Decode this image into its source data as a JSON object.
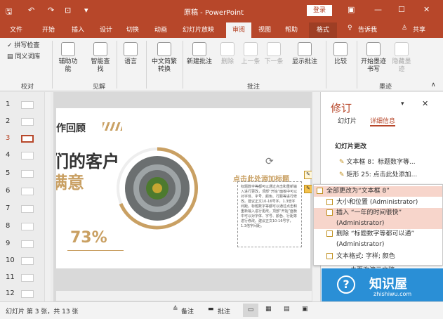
{
  "title_bar": {
    "title": "原稿 - PowerPoint",
    "login": "登录"
  },
  "tabs": [
    "文件",
    "开始",
    "插入",
    "设计",
    "切换",
    "动画",
    "幻灯片放映",
    "审阅",
    "视图",
    "帮助",
    "格式",
    "告诉我",
    "共享"
  ],
  "ribbon": {
    "spell": "拼写检查",
    "thesaurus": "同义词库",
    "g_proof": "校对",
    "accessibility": "辅助功能",
    "smart_lookup": "智能查找",
    "g_insight": "见解",
    "language": "语言",
    "chinese_conv": "中文简繁转换",
    "new_comment": "新建批注",
    "delete": "删除",
    "prev": "上一条",
    "next": "下一条",
    "show_comments": "显示批注",
    "g_comments": "批注",
    "compare": "比较",
    "start_ink": "开始墨迹书写",
    "hide_ink": "隐藏墨迹",
    "g_ink": "墨迹"
  },
  "thumbs": [
    "1",
    "2",
    "3",
    "4",
    "5",
    "6",
    "7",
    "8",
    "9",
    "10",
    "11",
    "12"
  ],
  "slide": {
    "heading": "作回顾",
    "title_line": "们的客户",
    "title_line2": "满意",
    "percent": "73%",
    "placeholder": "点击此处添加标题",
    "body_text": "标题数字等都可以通过点击和重新输入进行更改，顶部“开始”面板中可以对字体、字号、颜色、行距等进行修改。建议正文10-16号字，1.3倍字间距。标题数字等都可以通过点击和重新输入进行更改，顶部“开始”面板中可以对字体、字号、颜色、行距等进行修改。建议正文10-16号字，1.3倍字间距。"
  },
  "revision": {
    "title": "修订",
    "tab_slides": "幻灯片",
    "tab_details": "详细信息",
    "section": "幻灯片更改",
    "changes": [
      "文本框 8：标题数字等...",
      "矩形 25: 点击此处添加..."
    ],
    "footer": "未更改演示文稿。"
  },
  "popup": {
    "all": "全部更改为“文本框 8”",
    "items": [
      "大小和位置 (Administrator)",
      "插入 “一年的时间很快”",
      "(Administrator)",
      "删除 “标题数字等都可以通”",
      "(Administrator)",
      "文本格式: 字样; 颜色"
    ]
  },
  "status": {
    "slide_info": "幻灯片 第 3 张，共 13 张",
    "notes": "备注",
    "comments": "批注"
  },
  "watermark": {
    "cn": "知识屋",
    "en": "zhishiwu.com"
  },
  "colors": {
    "brand": "#b7472a",
    "accent_gold": "#c9a063"
  }
}
